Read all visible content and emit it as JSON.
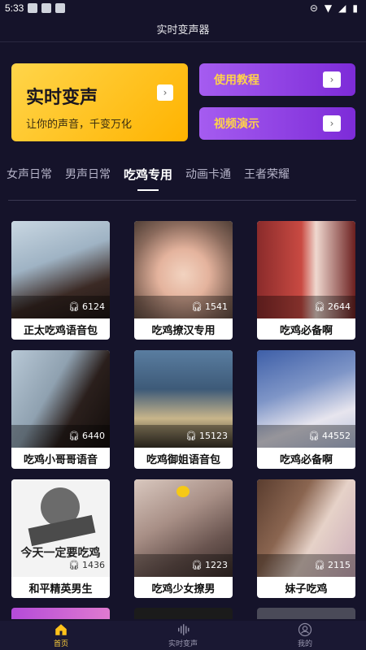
{
  "status": {
    "time": "5:33"
  },
  "app": {
    "title": "实时变声器"
  },
  "hero": {
    "title": "实时变声",
    "subtitle": "让你的声音，千变万化",
    "arrow": "›"
  },
  "ctas": [
    {
      "label": "使用教程",
      "arrow": "›"
    },
    {
      "label": "视频演示",
      "arrow": "›"
    }
  ],
  "tabs": [
    {
      "label": "女声日常"
    },
    {
      "label": "男声日常"
    },
    {
      "label": "吃鸡专用"
    },
    {
      "label": "动画卡通"
    },
    {
      "label": "王者荣耀"
    }
  ],
  "active_tab": "吃鸡专用",
  "cards": [
    {
      "title": "正太吃鸡语音包",
      "plays": "6124"
    },
    {
      "title": "吃鸡撩汉专用",
      "plays": "1541"
    },
    {
      "title": "吃鸡必备啊",
      "plays": "2644"
    },
    {
      "title": "吃鸡小哥哥语音",
      "plays": "6440"
    },
    {
      "title": "吃鸡御姐语音包",
      "plays": "15123"
    },
    {
      "title": "吃鸡必备啊",
      "plays": "44552"
    },
    {
      "title": "和平精英男生",
      "plays": "1436",
      "overlay": "今天一定要吃鸡"
    },
    {
      "title": "吃鸡少女撩男",
      "plays": "1223"
    },
    {
      "title": "妹子吃鸡",
      "plays": "2115"
    }
  ],
  "bottom_nav": [
    {
      "label": "首页",
      "icon": "home-icon"
    },
    {
      "label": "实时变声",
      "icon": "waveform-icon"
    },
    {
      "label": "我的",
      "icon": "user-icon"
    }
  ],
  "colors": {
    "accent_yellow": "#ffc21a",
    "accent_purple": "#8e3be6",
    "bg": "#15132a"
  }
}
